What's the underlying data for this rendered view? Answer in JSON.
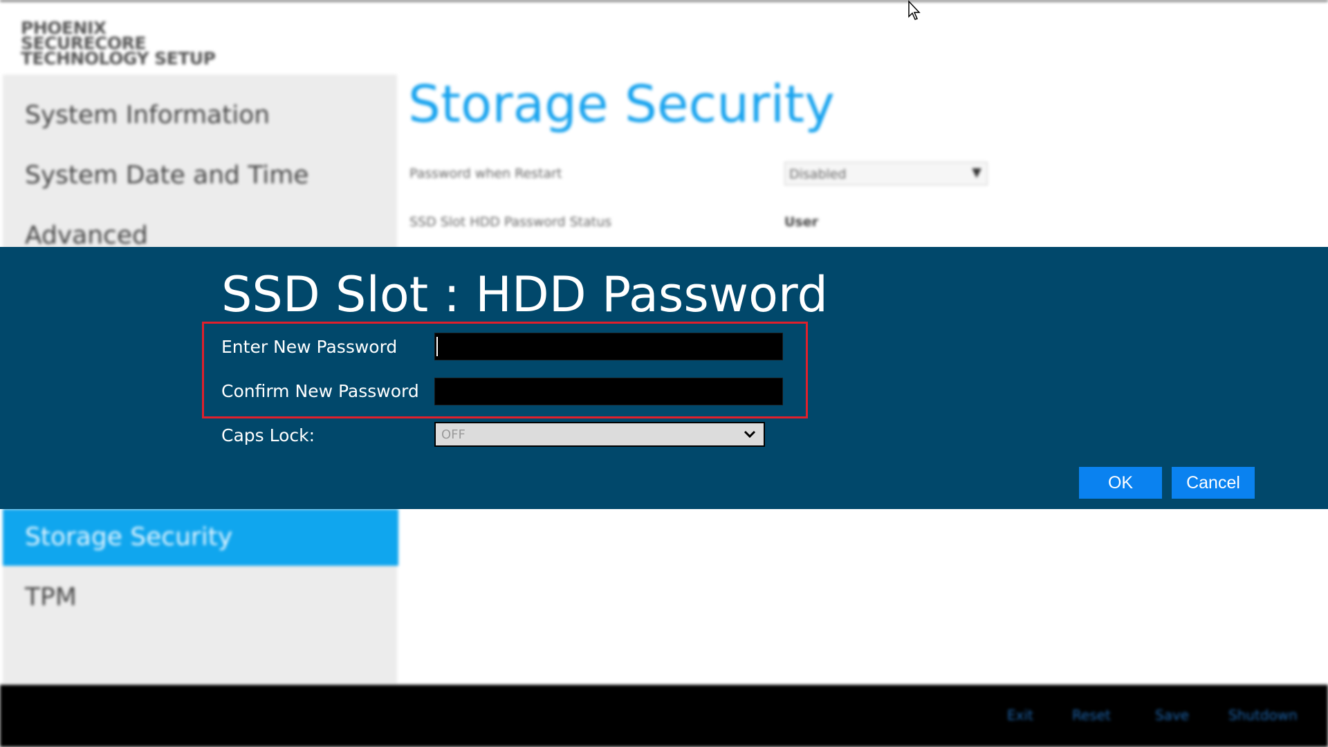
{
  "background": {
    "logo_line1": "PHOENIX SECURECORE",
    "logo_line2": "TECHNOLOGY SETUP",
    "sidebar": {
      "items": [
        {
          "label": "System Information"
        },
        {
          "label": "System Date and Time"
        },
        {
          "label": "Advanced"
        },
        {
          "label": "Storage Security"
        },
        {
          "label": "TPM"
        }
      ]
    },
    "page_title": "Storage Security",
    "settings": {
      "password_when_restart_label": "Password when Restart",
      "password_when_restart_value": "Disabled",
      "status_label": "SSD Slot HDD Password Status",
      "status_value": "User"
    },
    "bottom_bar": {
      "exit": "Exit",
      "reset": "Reset",
      "save": "Save",
      "shutdown": "Shutdown"
    }
  },
  "dialog": {
    "title": "SSD Slot : HDD Password",
    "enter_label": "Enter New Password",
    "confirm_label": "Confirm New Password",
    "caps_label": "Caps Lock:",
    "caps_value": "OFF",
    "ok_label": "OK",
    "cancel_label": "Cancel"
  },
  "colors": {
    "dialog_bg": "#01486b",
    "accent": "#10a6ee",
    "button": "#0a82f0",
    "highlight": "#e0202c"
  }
}
